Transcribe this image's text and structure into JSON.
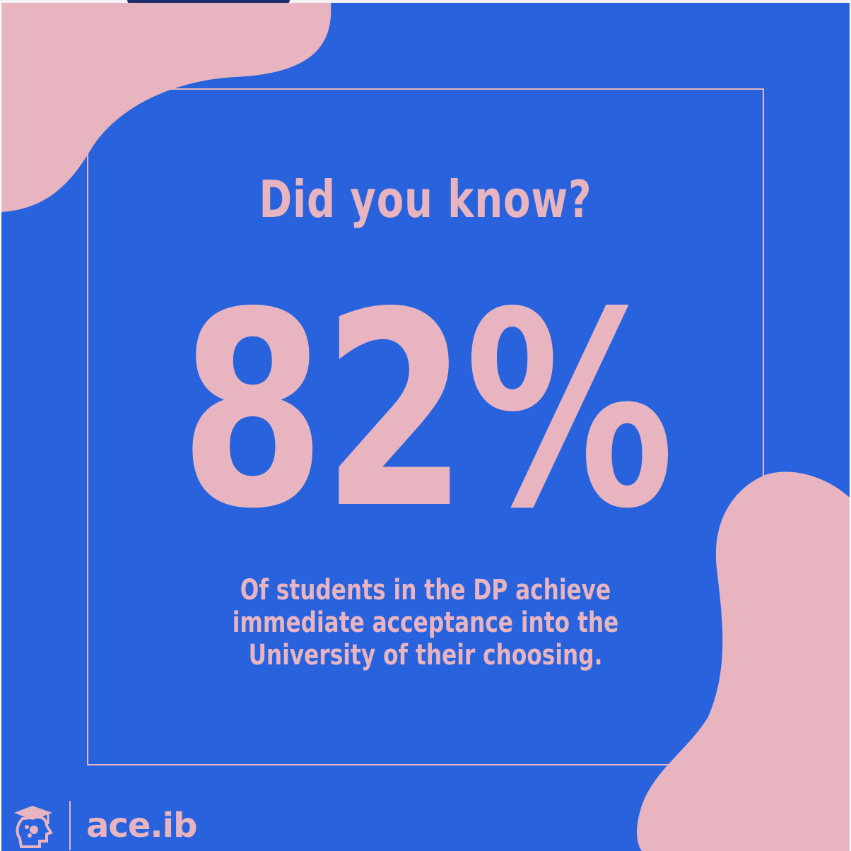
{
  "post": {
    "heading": "Did you know?",
    "statistic": "82%",
    "caption_lines": [
      "Of students in the DP achieve",
      "immediate acceptance into the",
      "University of their choosing."
    ]
  },
  "brand": {
    "logo_icon": "graduate-head-icon",
    "name": "ace.ib"
  },
  "colors": {
    "background": "#2862dd",
    "accent_pink": "#e8b4c0"
  }
}
